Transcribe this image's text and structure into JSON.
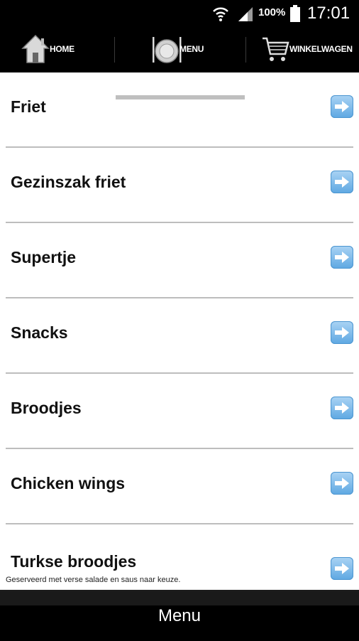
{
  "status_bar": {
    "battery": "100%",
    "time": "17:01",
    "icons": [
      "wifi-icon",
      "signal-icon",
      "battery-icon"
    ]
  },
  "tabs": [
    {
      "label": "HOME",
      "icon": "home-icon"
    },
    {
      "label": "MENU",
      "icon": "plate-icon",
      "active": true
    },
    {
      "label": "WINKELWAGEN",
      "icon": "cart-icon"
    }
  ],
  "menu_items": [
    {
      "label": "Friet"
    },
    {
      "label": "Gezinszak friet"
    },
    {
      "label": "Supertje"
    },
    {
      "label": "Snacks"
    },
    {
      "label": "Broodjes"
    },
    {
      "label": "Chicken wings"
    },
    {
      "label": "Turkse broodjes"
    }
  ],
  "footnote": "Geserveerd met verse salade en saus naar keuze.",
  "bottom_bar": {
    "title": "Menu"
  },
  "colors": {
    "arrow_button": "#5ea8e2",
    "bar_background": "#000000",
    "separator": "#bdbdbd"
  }
}
